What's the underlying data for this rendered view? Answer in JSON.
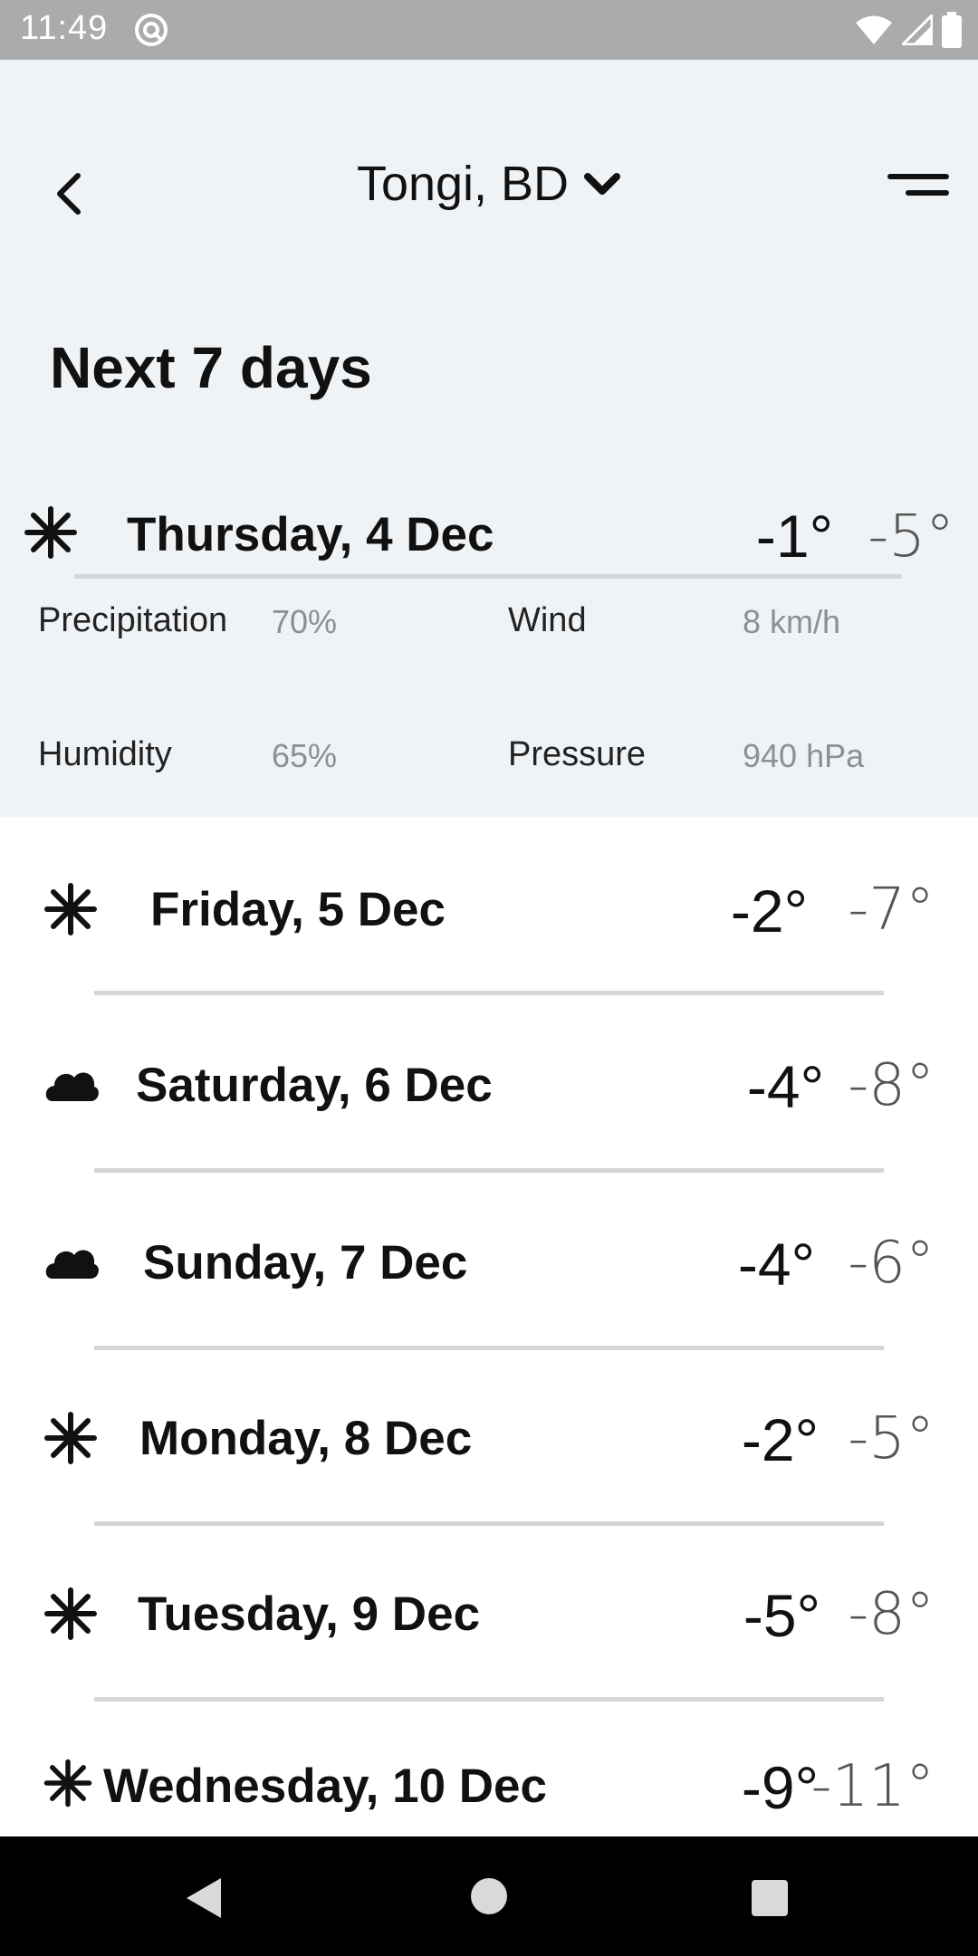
{
  "status_bar": {
    "time": "11:49"
  },
  "header": {
    "location": "Tongi, BD",
    "title": "Next 7 days"
  },
  "selected_day": {
    "label": "Thursday, 4 Dec",
    "high": "-1°",
    "low": "-5°",
    "icon": "snowflake-icon",
    "details": {
      "precipitation_label": "Precipitation",
      "precipitation_value": "70%",
      "wind_label": "Wind",
      "wind_value": "8 km/h",
      "humidity_label": "Humidity",
      "humidity_value": "65%",
      "pressure_label": "Pressure",
      "pressure_value": "940 hPa"
    }
  },
  "days": [
    {
      "label": "Friday, 5 Dec",
      "high": "-2°",
      "low": "-7°",
      "icon": "snowflake-icon"
    },
    {
      "label": "Saturday, 6 Dec",
      "high": "-4°",
      "low": "-8°",
      "icon": "cloud-icon"
    },
    {
      "label": "Sunday, 7 Dec",
      "high": "-4°",
      "low": "-6°",
      "icon": "cloud-icon"
    },
    {
      "label": "Monday, 8 Dec",
      "high": "-2°",
      "low": "-5°",
      "icon": "snowflake-icon"
    },
    {
      "label": "Tuesday, 9 Dec",
      "high": "-5°",
      "low": "-8°",
      "icon": "snowflake-icon"
    },
    {
      "label": "Wednesday, 10 Dec",
      "high": "-9°",
      "low": "-11°",
      "icon": "snowflake-icon"
    }
  ],
  "colors": {
    "header_bg": "#f0f3f6",
    "status_bar": "#a9abad",
    "divider": "#d4d7da",
    "muted_text": "#8d8f92"
  }
}
